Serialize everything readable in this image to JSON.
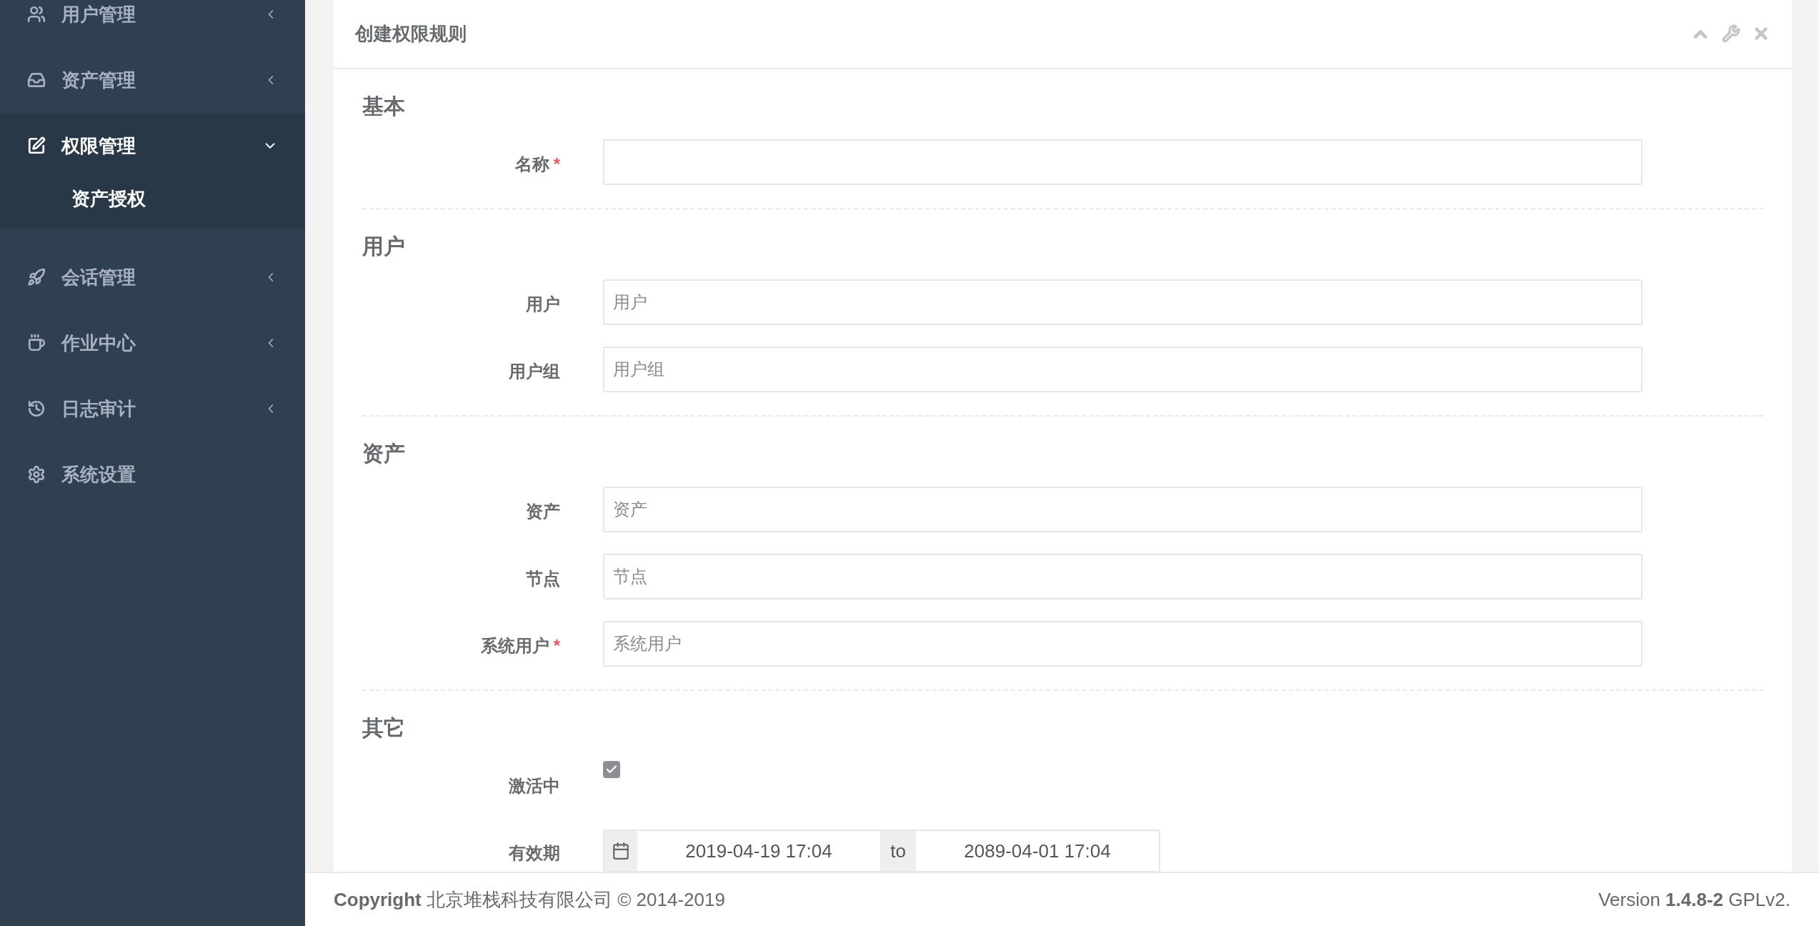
{
  "sidebar": {
    "items": [
      {
        "label": "用户管理",
        "kind": "group",
        "expanded": false,
        "selected": false
      },
      {
        "label": "资产管理",
        "kind": "group",
        "expanded": false,
        "selected": false
      },
      {
        "label": "权限管理",
        "kind": "group",
        "expanded": true,
        "selected": true,
        "children": [
          {
            "label": "资产授权",
            "selected": true
          }
        ]
      },
      {
        "label": "会话管理",
        "kind": "group",
        "expanded": false,
        "selected": false
      },
      {
        "label": "作业中心",
        "kind": "group",
        "expanded": false,
        "selected": false
      },
      {
        "label": "日志审计",
        "kind": "group",
        "expanded": false,
        "selected": false
      },
      {
        "label": "系统设置",
        "kind": "link",
        "selected": false
      }
    ]
  },
  "card": {
    "title": "创建权限规则",
    "sections": [
      {
        "title": "基本",
        "fields": [
          {
            "kind": "text",
            "label": "名称",
            "required_mark": "*"
          }
        ]
      },
      {
        "title": "用户",
        "fields": [
          {
            "kind": "text",
            "label": "用户",
            "placeholder": "用户"
          },
          {
            "kind": "text",
            "label": "用户组",
            "placeholder": "用户组"
          }
        ]
      },
      {
        "title": "资产",
        "fields": [
          {
            "kind": "text",
            "label": "资产",
            "placeholder": "资产"
          },
          {
            "kind": "text",
            "label": "节点",
            "placeholder": "节点"
          },
          {
            "kind": "text",
            "label": "系统用户",
            "required_mark": "*",
            "placeholder": "系统用户"
          }
        ]
      },
      {
        "title": "其它",
        "fields": [
          {
            "kind": "checkbox",
            "label": "激活中",
            "checked": true
          },
          {
            "kind": "daterange",
            "label": "有效期",
            "start": "2019-04-19 17:04",
            "separator": "to",
            "end": "2089-04-01 17:04"
          }
        ]
      }
    ]
  },
  "footer": {
    "copyright": "**Copyright** 北京堆栈科技有限公司 © 2014-2019",
    "version": "Version **1.4.8-2** GPLv2."
  }
}
